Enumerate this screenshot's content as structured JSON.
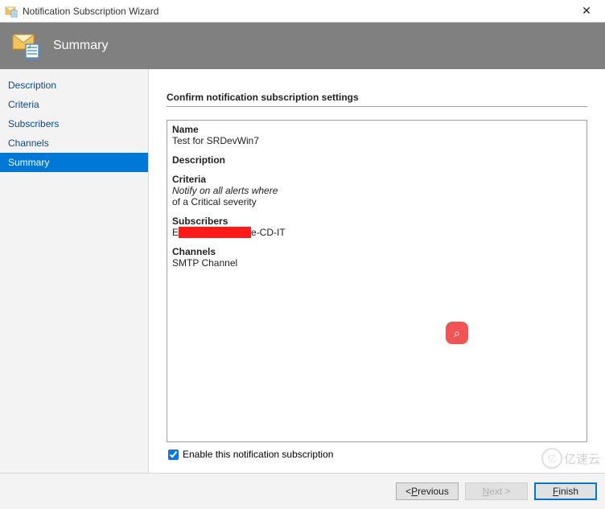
{
  "titlebar": {
    "title": "Notification Subscription Wizard",
    "close_glyph": "✕"
  },
  "header": {
    "title": "Summary"
  },
  "sidebar": {
    "items": [
      {
        "label": "Description"
      },
      {
        "label": "Criteria"
      },
      {
        "label": "Subscribers"
      },
      {
        "label": "Channels"
      },
      {
        "label": "Summary",
        "selected": true
      }
    ]
  },
  "content": {
    "heading": "Confirm notification subscription settings",
    "summary": {
      "name_label": "Name",
      "name_value": "Test for SRDevWin7",
      "description_label": "Description",
      "description_value": "",
      "criteria_label": "Criteria",
      "criteria_line1": "Notify on all alerts where",
      "criteria_line2": " of a Critical severity",
      "subscribers_label": "Subscribers",
      "subscriber_prefix": "E",
      "subscriber_suffix": "e-CD-IT",
      "channels_label": "Channels",
      "channels_value": "SMTP Channel"
    },
    "enable_checkbox_label": "Enable this notification subscription",
    "enable_checked": true
  },
  "footer": {
    "previous_label_pre": "< ",
    "previous_hot": "P",
    "previous_label_post": "revious",
    "next_hot": "N",
    "next_label_post": "ext >",
    "finish_pre": "",
    "finish_hot": "F",
    "finish_post": "inish"
  },
  "watermark": {
    "text": "亿速云"
  },
  "decor": {
    "search_glyph": "⌕"
  }
}
